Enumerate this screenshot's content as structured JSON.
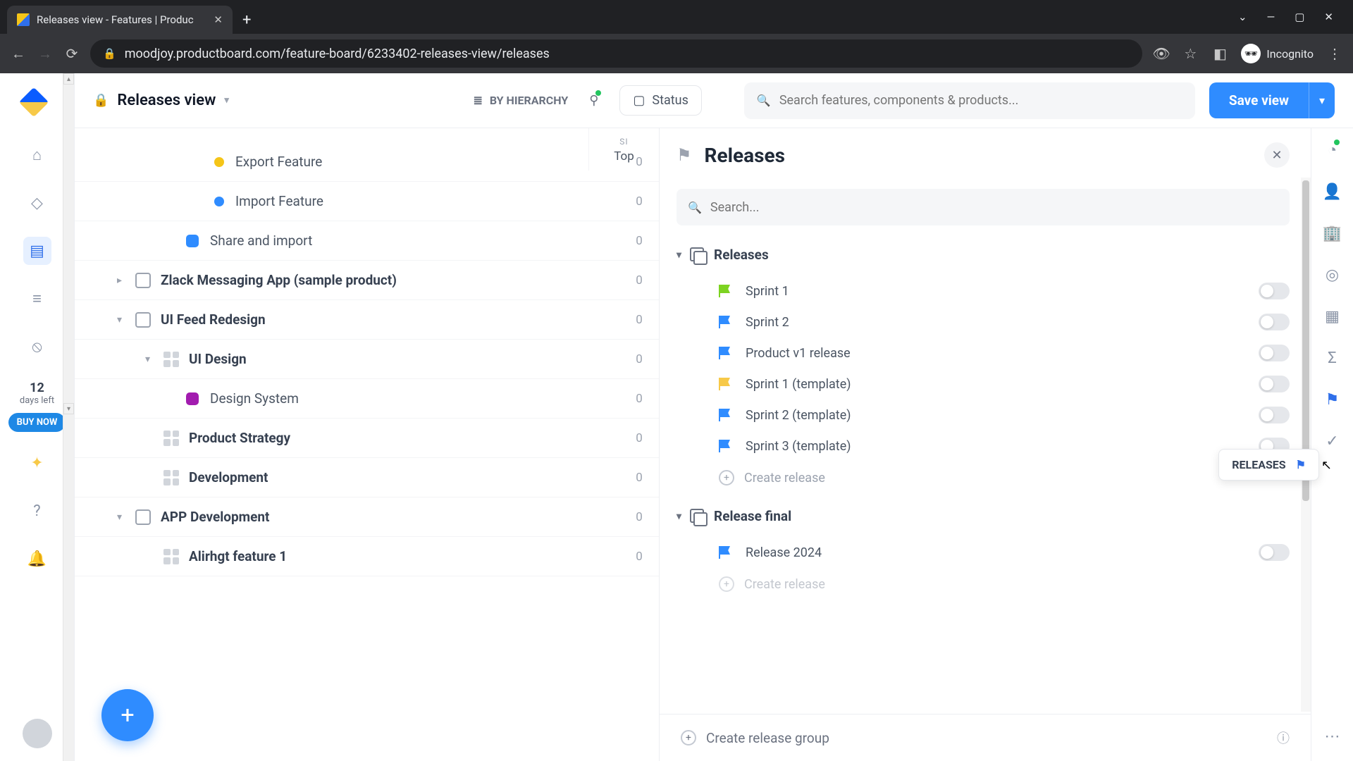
{
  "browser": {
    "tab_title": "Releases view - Features | Produc",
    "url": "moodjoy.productboard.com/feature-board/6233402-releases-view/releases",
    "incognito_label": "Incognito"
  },
  "topbar": {
    "view_title": "Releases view",
    "hierarchy_label": "BY HIERARCHY",
    "status_label": "Status",
    "search_placeholder": "Search features, components & products...",
    "save_label": "Save view"
  },
  "col": {
    "sm": "SI",
    "top": "Top"
  },
  "features": [
    {
      "name": "Export Feature",
      "style": "dot",
      "color": "#f5c518",
      "indent": 4,
      "count": "0",
      "bold": false
    },
    {
      "name": "Import Feature",
      "style": "dot",
      "color": "#2f8cff",
      "indent": 4,
      "count": "0",
      "bold": false
    },
    {
      "name": "Share and import",
      "style": "sq",
      "color": "#2f8cff",
      "indent": 3,
      "count": "0",
      "bold": false
    },
    {
      "name": "Zlack Messaging App (sample product)",
      "style": "folder",
      "indent": 1,
      "count": "0",
      "bold": true,
      "expand": "▸"
    },
    {
      "name": "UI Feed Redesign",
      "style": "folder",
      "indent": 1,
      "count": "0",
      "bold": true,
      "expand": "▾"
    },
    {
      "name": "UI Design",
      "style": "grid",
      "indent": 2,
      "count": "0",
      "bold": true,
      "expand": "▾"
    },
    {
      "name": "Design System",
      "style": "sq",
      "color": "#a21caf",
      "indent": 3,
      "count": "0",
      "bold": false
    },
    {
      "name": "Product Strategy",
      "style": "grid",
      "indent": 2,
      "count": "0",
      "bold": true
    },
    {
      "name": "Development",
      "style": "grid",
      "indent": 2,
      "count": "0",
      "bold": true
    },
    {
      "name": "APP Development",
      "style": "folder",
      "indent": 1,
      "count": "0",
      "bold": true,
      "expand": "▾"
    },
    {
      "name": "Alirhgt feature 1",
      "style": "grid",
      "indent": 2,
      "count": "0",
      "bold": true
    }
  ],
  "trial": {
    "num": "12",
    "label": "days left",
    "buy": "BUY NOW"
  },
  "panel": {
    "title": "Releases",
    "search_placeholder": "Search...",
    "group1": "Releases",
    "group2": "Release final",
    "items": [
      {
        "name": "Sprint 1",
        "color": "#7dd321"
      },
      {
        "name": "Sprint 2",
        "color": "#2f8cff"
      },
      {
        "name": "Product v1 release",
        "color": "#2f8cff"
      },
      {
        "name": "Sprint 1 (template)",
        "color": "#f7c948"
      },
      {
        "name": "Sprint 2 (template)",
        "color": "#2f8cff"
      },
      {
        "name": "Sprint 3 (template)",
        "color": "#2f8cff"
      }
    ],
    "items2": [
      {
        "name": "Release 2024",
        "color": "#2f8cff"
      }
    ],
    "create_release": "Create release",
    "create_group": "Create release group"
  },
  "tooltip": {
    "label": "RELEASES"
  }
}
